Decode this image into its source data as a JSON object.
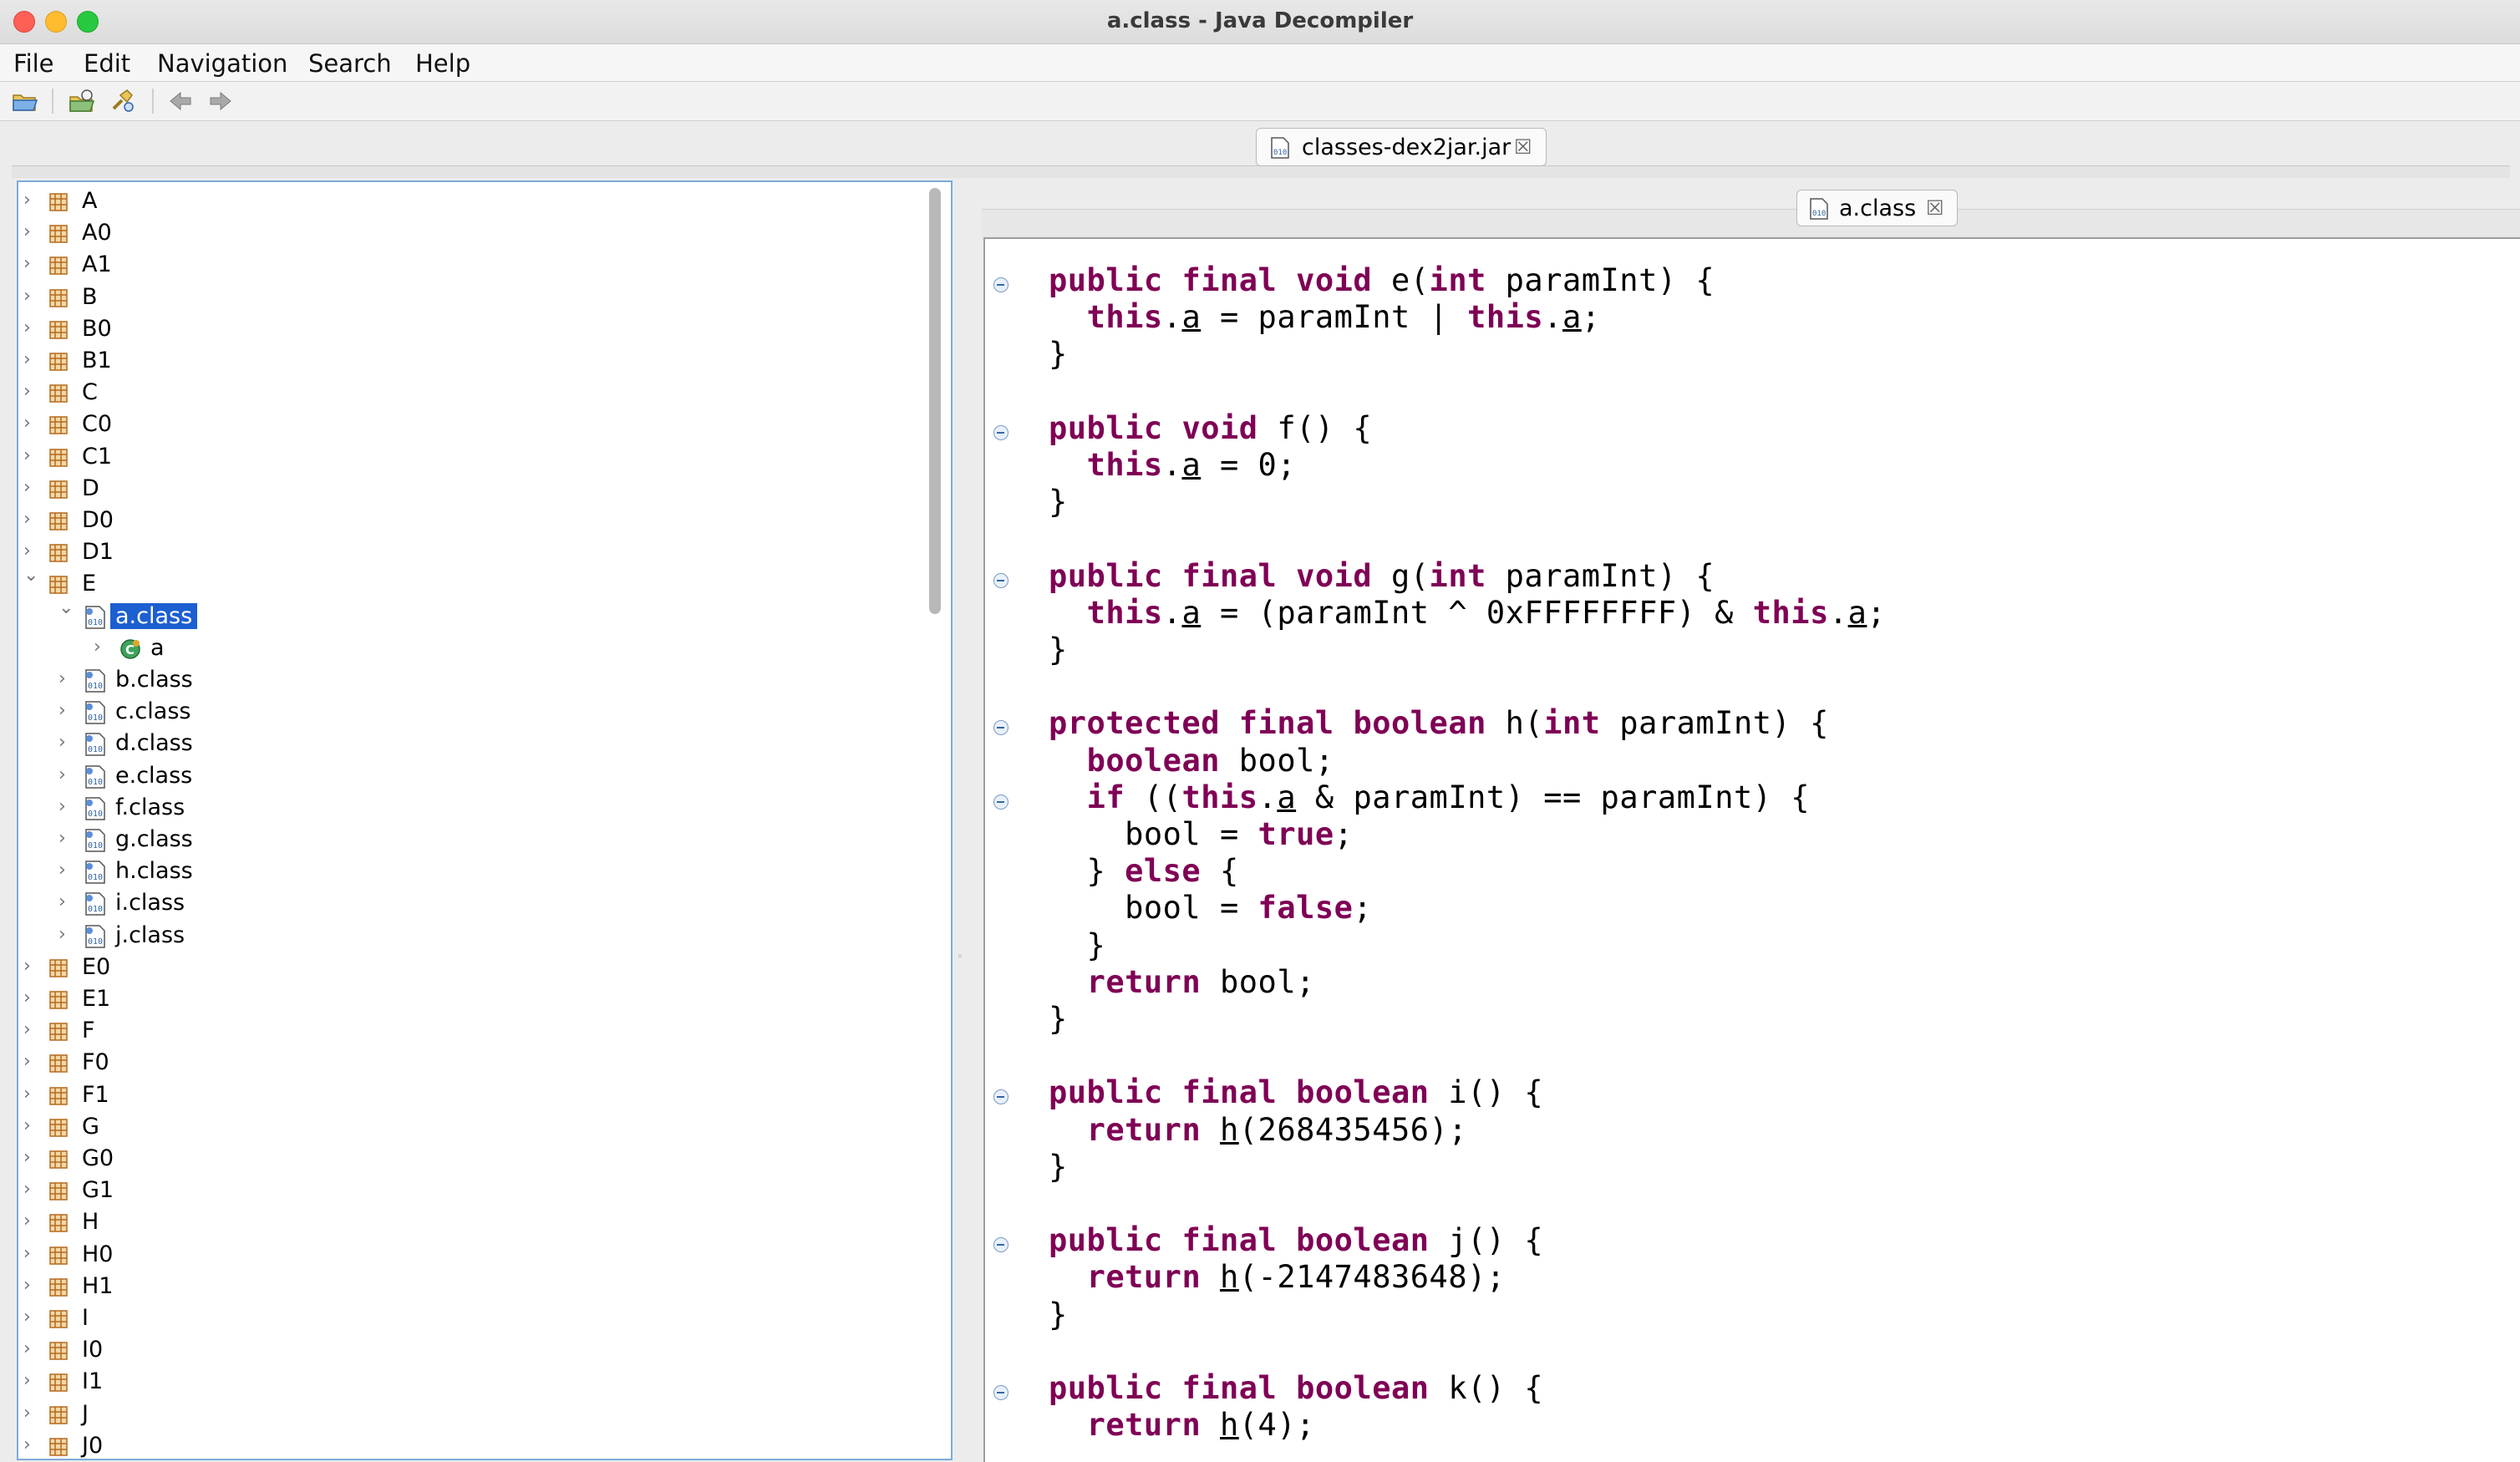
{
  "window": {
    "title": "a.class - Java Decompiler"
  },
  "menu": [
    "File",
    "Edit",
    "Navigation",
    "Search",
    "Help"
  ],
  "toolbar_icons": [
    "open-file-icon",
    "open-type-icon",
    "search-icon",
    "back-arrow-icon",
    "forward-arrow-icon"
  ],
  "tabs": {
    "jar": {
      "label": "classes-dex2jar.jar"
    },
    "class": {
      "label": "a.class"
    }
  },
  "tree": [
    {
      "label": "A",
      "type": "package",
      "depth": 0,
      "expanded": false
    },
    {
      "label": "A0",
      "type": "package",
      "depth": 0,
      "expanded": false
    },
    {
      "label": "A1",
      "type": "package",
      "depth": 0,
      "expanded": false
    },
    {
      "label": "B",
      "type": "package",
      "depth": 0,
      "expanded": false
    },
    {
      "label": "B0",
      "type": "package",
      "depth": 0,
      "expanded": false
    },
    {
      "label": "B1",
      "type": "package",
      "depth": 0,
      "expanded": false
    },
    {
      "label": "C",
      "type": "package",
      "depth": 0,
      "expanded": false
    },
    {
      "label": "C0",
      "type": "package",
      "depth": 0,
      "expanded": false
    },
    {
      "label": "C1",
      "type": "package",
      "depth": 0,
      "expanded": false
    },
    {
      "label": "D",
      "type": "package",
      "depth": 0,
      "expanded": false
    },
    {
      "label": "D0",
      "type": "package",
      "depth": 0,
      "expanded": false
    },
    {
      "label": "D1",
      "type": "package",
      "depth": 0,
      "expanded": false
    },
    {
      "label": "E",
      "type": "package",
      "depth": 0,
      "expanded": true
    },
    {
      "label": "a.class",
      "type": "class",
      "depth": 1,
      "expanded": true,
      "selected": true
    },
    {
      "label": "a",
      "type": "member",
      "depth": 2,
      "expanded": false
    },
    {
      "label": "b.class",
      "type": "class",
      "depth": 1,
      "expanded": false
    },
    {
      "label": "c.class",
      "type": "class",
      "depth": 1,
      "expanded": false
    },
    {
      "label": "d.class",
      "type": "class",
      "depth": 1,
      "expanded": false
    },
    {
      "label": "e.class",
      "type": "class",
      "depth": 1,
      "expanded": false
    },
    {
      "label": "f.class",
      "type": "class",
      "depth": 1,
      "expanded": false
    },
    {
      "label": "g.class",
      "type": "class",
      "depth": 1,
      "expanded": false
    },
    {
      "label": "h.class",
      "type": "class",
      "depth": 1,
      "expanded": false
    },
    {
      "label": "i.class",
      "type": "class",
      "depth": 1,
      "expanded": false
    },
    {
      "label": "j.class",
      "type": "class",
      "depth": 1,
      "expanded": false
    },
    {
      "label": "E0",
      "type": "package",
      "depth": 0,
      "expanded": false
    },
    {
      "label": "E1",
      "type": "package",
      "depth": 0,
      "expanded": false
    },
    {
      "label": "F",
      "type": "package",
      "depth": 0,
      "expanded": false
    },
    {
      "label": "F0",
      "type": "package",
      "depth": 0,
      "expanded": false
    },
    {
      "label": "F1",
      "type": "package",
      "depth": 0,
      "expanded": false
    },
    {
      "label": "G",
      "type": "package",
      "depth": 0,
      "expanded": false
    },
    {
      "label": "G0",
      "type": "package",
      "depth": 0,
      "expanded": false
    },
    {
      "label": "G1",
      "type": "package",
      "depth": 0,
      "expanded": false
    },
    {
      "label": "H",
      "type": "package",
      "depth": 0,
      "expanded": false
    },
    {
      "label": "H0",
      "type": "package",
      "depth": 0,
      "expanded": false
    },
    {
      "label": "H1",
      "type": "package",
      "depth": 0,
      "expanded": false
    },
    {
      "label": "I",
      "type": "package",
      "depth": 0,
      "expanded": false
    },
    {
      "label": "I0",
      "type": "package",
      "depth": 0,
      "expanded": false
    },
    {
      "label": "I1",
      "type": "package",
      "depth": 0,
      "expanded": false
    },
    {
      "label": "J",
      "type": "package",
      "depth": 0,
      "expanded": false
    },
    {
      "label": "J0",
      "type": "package",
      "depth": 0,
      "expanded": false
    }
  ],
  "code": [
    {
      "fold": true,
      "tokens": [
        [
          "kw",
          "public"
        ],
        [
          "t",
          " "
        ],
        [
          "kw",
          "final"
        ],
        [
          "t",
          " "
        ],
        [
          "kw",
          "void"
        ],
        [
          "t",
          " e("
        ],
        [
          "kw",
          "int"
        ],
        [
          "t",
          " paramInt) {"
        ]
      ]
    },
    {
      "fold": false,
      "tokens": [
        [
          "t",
          "  "
        ],
        [
          "kw",
          "this"
        ],
        [
          "t",
          "."
        ],
        [
          "u",
          "a"
        ],
        [
          "t",
          " = paramInt | "
        ],
        [
          "kw",
          "this"
        ],
        [
          "t",
          "."
        ],
        [
          "u",
          "a"
        ],
        [
          "t",
          ";"
        ]
      ]
    },
    {
      "fold": false,
      "tokens": [
        [
          "t",
          "}"
        ]
      ]
    },
    {
      "fold": false,
      "tokens": []
    },
    {
      "fold": true,
      "tokens": [
        [
          "kw",
          "public"
        ],
        [
          "t",
          " "
        ],
        [
          "kw",
          "void"
        ],
        [
          "t",
          " f() {"
        ]
      ]
    },
    {
      "fold": false,
      "tokens": [
        [
          "t",
          "  "
        ],
        [
          "kw",
          "this"
        ],
        [
          "t",
          "."
        ],
        [
          "u",
          "a"
        ],
        [
          "t",
          " = 0;"
        ]
      ]
    },
    {
      "fold": false,
      "tokens": [
        [
          "t",
          "}"
        ]
      ]
    },
    {
      "fold": false,
      "tokens": []
    },
    {
      "fold": true,
      "tokens": [
        [
          "kw",
          "public"
        ],
        [
          "t",
          " "
        ],
        [
          "kw",
          "final"
        ],
        [
          "t",
          " "
        ],
        [
          "kw",
          "void"
        ],
        [
          "t",
          " g("
        ],
        [
          "kw",
          "int"
        ],
        [
          "t",
          " paramInt) {"
        ]
      ]
    },
    {
      "fold": false,
      "tokens": [
        [
          "t",
          "  "
        ],
        [
          "kw",
          "this"
        ],
        [
          "t",
          "."
        ],
        [
          "u",
          "a"
        ],
        [
          "t",
          " = (paramInt ^ 0xFFFFFFFF) & "
        ],
        [
          "kw",
          "this"
        ],
        [
          "t",
          "."
        ],
        [
          "u",
          "a"
        ],
        [
          "t",
          ";"
        ]
      ]
    },
    {
      "fold": false,
      "tokens": [
        [
          "t",
          "}"
        ]
      ]
    },
    {
      "fold": false,
      "tokens": []
    },
    {
      "fold": true,
      "tokens": [
        [
          "kw",
          "protected"
        ],
        [
          "t",
          " "
        ],
        [
          "kw",
          "final"
        ],
        [
          "t",
          " "
        ],
        [
          "kw",
          "boolean"
        ],
        [
          "t",
          " h("
        ],
        [
          "kw",
          "int"
        ],
        [
          "t",
          " paramInt) {"
        ]
      ]
    },
    {
      "fold": false,
      "tokens": [
        [
          "t",
          "  "
        ],
        [
          "kw",
          "boolean"
        ],
        [
          "t",
          " bool;"
        ]
      ]
    },
    {
      "fold": true,
      "tokens": [
        [
          "t",
          "  "
        ],
        [
          "kw",
          "if"
        ],
        [
          "t",
          " (("
        ],
        [
          "kw",
          "this"
        ],
        [
          "t",
          "."
        ],
        [
          "u",
          "a"
        ],
        [
          "t",
          " & paramInt) == paramInt) {"
        ]
      ]
    },
    {
      "fold": false,
      "tokens": [
        [
          "t",
          "    bool = "
        ],
        [
          "kw",
          "true"
        ],
        [
          "t",
          ";"
        ]
      ]
    },
    {
      "fold": false,
      "tokens": [
        [
          "t",
          "  } "
        ],
        [
          "kw",
          "else"
        ],
        [
          "t",
          " {"
        ]
      ]
    },
    {
      "fold": false,
      "tokens": [
        [
          "t",
          "    bool = "
        ],
        [
          "kw",
          "false"
        ],
        [
          "t",
          ";"
        ]
      ]
    },
    {
      "fold": false,
      "tokens": [
        [
          "t",
          "  }"
        ]
      ]
    },
    {
      "fold": false,
      "tokens": [
        [
          "t",
          "  "
        ],
        [
          "kw",
          "return"
        ],
        [
          "t",
          " bool;"
        ]
      ]
    },
    {
      "fold": false,
      "tokens": [
        [
          "t",
          "}"
        ]
      ]
    },
    {
      "fold": false,
      "tokens": []
    },
    {
      "fold": true,
      "tokens": [
        [
          "kw",
          "public"
        ],
        [
          "t",
          " "
        ],
        [
          "kw",
          "final"
        ],
        [
          "t",
          " "
        ],
        [
          "kw",
          "boolean"
        ],
        [
          "t",
          " i() {"
        ]
      ]
    },
    {
      "fold": false,
      "tokens": [
        [
          "t",
          "  "
        ],
        [
          "kw",
          "return"
        ],
        [
          "t",
          " "
        ],
        [
          "u",
          "h"
        ],
        [
          "t",
          "(268435456);"
        ]
      ]
    },
    {
      "fold": false,
      "tokens": [
        [
          "t",
          "}"
        ]
      ]
    },
    {
      "fold": false,
      "tokens": []
    },
    {
      "fold": true,
      "tokens": [
        [
          "kw",
          "public"
        ],
        [
          "t",
          " "
        ],
        [
          "kw",
          "final"
        ],
        [
          "t",
          " "
        ],
        [
          "kw",
          "boolean"
        ],
        [
          "t",
          " j() {"
        ]
      ]
    },
    {
      "fold": false,
      "tokens": [
        [
          "t",
          "  "
        ],
        [
          "kw",
          "return"
        ],
        [
          "t",
          " "
        ],
        [
          "u",
          "h"
        ],
        [
          "t",
          "(-2147483648);"
        ]
      ]
    },
    {
      "fold": false,
      "tokens": [
        [
          "t",
          "}"
        ]
      ]
    },
    {
      "fold": false,
      "tokens": []
    },
    {
      "fold": true,
      "tokens": [
        [
          "kw",
          "public"
        ],
        [
          "t",
          " "
        ],
        [
          "kw",
          "final"
        ],
        [
          "t",
          " "
        ],
        [
          "kw",
          "boolean"
        ],
        [
          "t",
          " k() {"
        ]
      ]
    },
    {
      "fold": false,
      "tokens": [
        [
          "t",
          "  "
        ],
        [
          "kw",
          "return"
        ],
        [
          "t",
          " "
        ],
        [
          "u",
          "h"
        ],
        [
          "t",
          "(4);"
        ]
      ]
    }
  ],
  "colors": {
    "keyword": "#7f0055",
    "selection": "#1c5fd1",
    "tree_focus_border": "#7fa9d9"
  }
}
